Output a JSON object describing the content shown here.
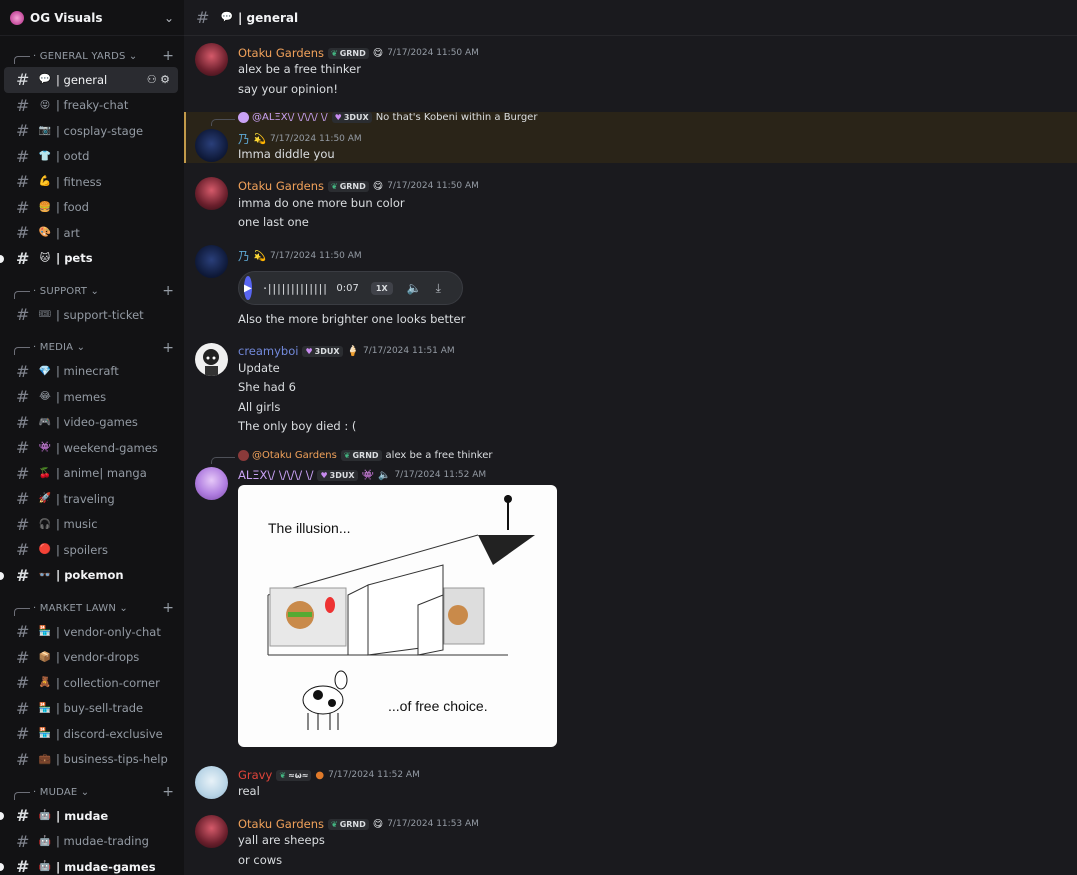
{
  "server": {
    "name": "OG Visuals"
  },
  "channel_header": {
    "title": "| general"
  },
  "sidebar": {
    "categories": [
      {
        "label": "GENERAL YARDS",
        "channels": [
          {
            "emoji": "💬",
            "name": "| general",
            "state": "active"
          },
          {
            "emoji": "😝",
            "name": "| freaky-chat",
            "state": "normal"
          },
          {
            "emoji": "📷",
            "name": "| cosplay-stage",
            "state": "normal"
          },
          {
            "emoji": "👕",
            "name": "| ootd",
            "state": "normal"
          },
          {
            "emoji": "💪",
            "name": "| fitness",
            "state": "normal"
          },
          {
            "emoji": "🍔",
            "name": "| food",
            "state": "normal"
          },
          {
            "emoji": "🎨",
            "name": "| art",
            "state": "normal"
          },
          {
            "emoji": "🐱",
            "name": "| pets",
            "state": "unread"
          }
        ]
      },
      {
        "label": "SUPPORT",
        "channels": [
          {
            "emoji": "🎟",
            "name": "| support-ticket",
            "state": "normal"
          }
        ]
      },
      {
        "label": "MEDIA",
        "channels": [
          {
            "emoji": "💎",
            "name": "| minecraft",
            "state": "normal"
          },
          {
            "emoji": "😂",
            "name": "| memes",
            "state": "normal"
          },
          {
            "emoji": "🎮",
            "name": "| video-games",
            "state": "normal"
          },
          {
            "emoji": "👾",
            "name": "| weekend-games",
            "state": "normal"
          },
          {
            "emoji": "🍒",
            "name": "| anime| manga",
            "state": "normal"
          },
          {
            "emoji": "🚀",
            "name": "| traveling",
            "state": "normal"
          },
          {
            "emoji": "🎧",
            "name": "| music",
            "state": "normal"
          },
          {
            "emoji": "🔴",
            "name": "| spoilers",
            "state": "normal"
          },
          {
            "emoji": "👓",
            "name": "| pokemon",
            "state": "unread"
          }
        ]
      },
      {
        "label": "MARKET LAWN",
        "channels": [
          {
            "emoji": "🏪",
            "name": "| vendor-only-chat",
            "state": "normal"
          },
          {
            "emoji": "📦",
            "name": "| vendor-drops",
            "state": "normal"
          },
          {
            "emoji": "🧸",
            "name": "| collection-corner",
            "state": "normal"
          },
          {
            "emoji": "🏪",
            "name": "| buy-sell-trade",
            "state": "normal"
          },
          {
            "emoji": "🏪",
            "name": "| discord-exclusive",
            "state": "normal"
          },
          {
            "emoji": "💼",
            "name": "| business-tips-help",
            "state": "normal"
          }
        ]
      },
      {
        "label": "MUDAE",
        "channels": [
          {
            "emoji": "🤖",
            "name": "| mudae",
            "state": "unread"
          },
          {
            "emoji": "🤖",
            "name": "| mudae-trading",
            "state": "normal"
          },
          {
            "emoji": "🤖",
            "name": "| mudae-games",
            "state": "unread"
          }
        ]
      }
    ]
  },
  "messages": {
    "m1": {
      "author": "Otaku Gardens",
      "author_color": "#f0a15a",
      "tag": "GRND",
      "time": "7/17/2024 11:50 AM",
      "lines": [
        "alex be a free thinker",
        "say your opinion!"
      ]
    },
    "m2": {
      "reply_to": "@ALΞX\\/ \\/\\/\\/ \\/",
      "reply_tag": "3DUX",
      "reply_text": "No that's Kobeni within a Burger",
      "author": "乃",
      "author_color": "#5fa8d3",
      "time": "7/17/2024 11:50 AM",
      "lines": [
        "Imma diddle you"
      ]
    },
    "m3": {
      "author": "Otaku Gardens",
      "author_color": "#f0a15a",
      "tag": "GRND",
      "time": "7/17/2024 11:50 AM",
      "lines": [
        "imma do one more bun color",
        "one last one"
      ]
    },
    "m4": {
      "author": "乃",
      "author_color": "#5fa8d3",
      "time": "7/17/2024 11:50 AM",
      "audio": {
        "waveform": "·|||||||||||||",
        "duration": "0:07",
        "speed": "1X"
      },
      "lines": [
        "Also the more brighter one looks better"
      ]
    },
    "m5": {
      "author": "creamyboi",
      "author_color": "#7289da",
      "tag": "3DUX",
      "time": "7/17/2024 11:51 AM",
      "lines": [
        "Update",
        "She had 6",
        "All girls",
        "The only boy died : ("
      ]
    },
    "m6": {
      "reply_to": "@Otaku Gardens",
      "reply_tag": "GRND",
      "reply_text": "alex be a free thinker",
      "author": "ALΞX\\/ \\/\\/\\/ \\/",
      "author_color": "#c9a2f5",
      "tag": "3DUX",
      "time": "7/17/2024 11:52 AM",
      "image": {
        "top_text": "The illusion...",
        "bottom_text": "...of free choice."
      }
    },
    "m7": {
      "author": "Gravy",
      "author_color": "#e0443a",
      "tag": "≈ω≈",
      "time": "7/17/2024 11:52 AM",
      "lines": [
        "real"
      ]
    },
    "m8": {
      "author": "Otaku Gardens",
      "author_color": "#f0a15a",
      "tag": "GRND",
      "time": "7/17/2024 11:53 AM",
      "lines": [
        "yall are sheeps",
        "or cows"
      ]
    }
  }
}
